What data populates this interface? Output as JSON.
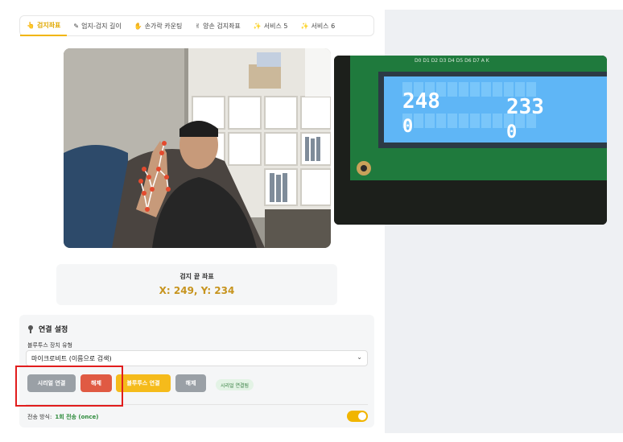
{
  "tabs": [
    {
      "icon": "👆",
      "label": "검지좌표",
      "active": true
    },
    {
      "icon": "✎",
      "label": "엄지-검지 길이",
      "active": false
    },
    {
      "icon": "✋",
      "label": "손가락 카운팅",
      "active": false
    },
    {
      "icon": "✌",
      "label": "양손 검지좌표",
      "active": false
    },
    {
      "icon": "✨",
      "label": "서비스 5",
      "active": false
    },
    {
      "icon": "✨",
      "label": "서비스 6",
      "active": false
    }
  ],
  "lcd": {
    "row1_left": "248",
    "row1_right": "233",
    "row2_left": "0",
    "row2_right": "0",
    "board_pins": "D0 D1 D2 D3 D4 D5 D6 D7 A K"
  },
  "coordinates": {
    "title": "검지 끝 좌표",
    "value": "X: 249, Y: 234"
  },
  "connection": {
    "title": "연결 설정",
    "device_type_label": "블루투스 장치 유형",
    "device_type_selected": "마이크로비트 (이름으로 검색)",
    "serial_connect_label": "시리얼 연결",
    "serial_disconnect_label": "해제",
    "bluetooth_connect_label": "블루투스 연결",
    "bluetooth_disconnect_label": "해제",
    "status_badge": "시리얼 연결됨",
    "send_mode_label": "전송 방식:",
    "send_mode_value": "1회 전송 (once)",
    "send_mode_toggle_on": true
  },
  "colors": {
    "accent": "#f1b500",
    "danger": "#e05a43",
    "neutral_button": "#9aa0a6",
    "coord_text": "#c7941e",
    "status_green": "#2f7a3a",
    "highlight": "#e11d1d"
  }
}
